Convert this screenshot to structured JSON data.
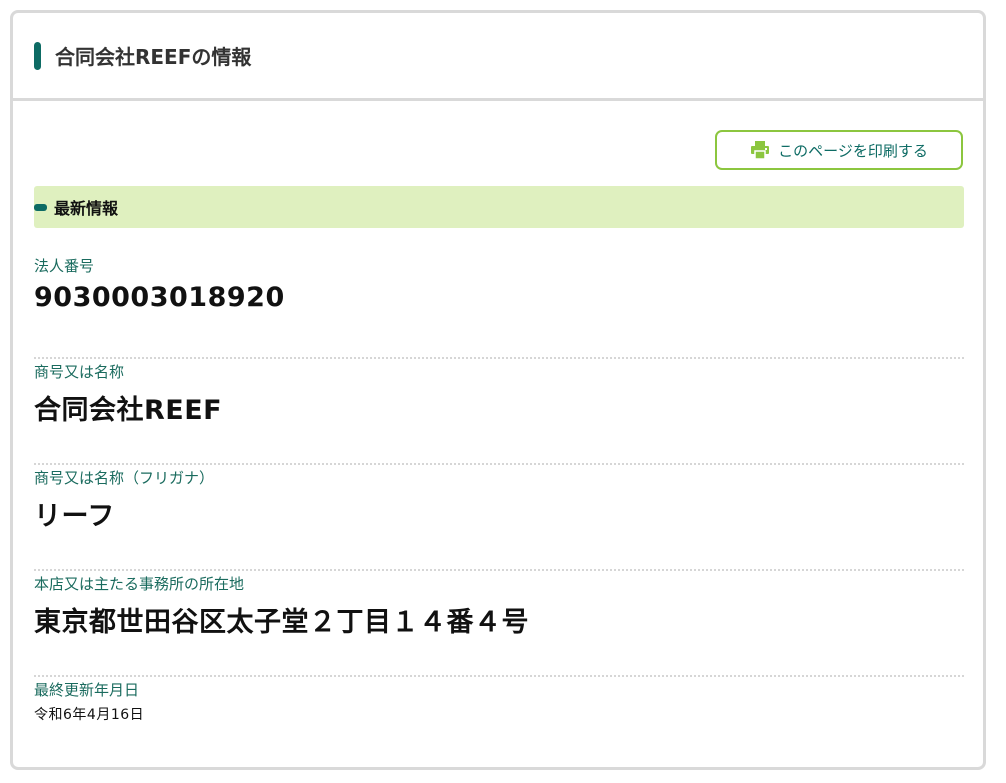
{
  "header": {
    "title": "合同会社REEFの情報"
  },
  "print_button": {
    "label": "このページを印刷する",
    "icon": "printer-icon"
  },
  "section": {
    "title": "最新情報"
  },
  "fields": [
    {
      "label": "法人番号",
      "value": "9030003018920"
    },
    {
      "label": "商号又は名称",
      "value": "合同会社REEF"
    },
    {
      "label": "商号又は名称（フリガナ）",
      "value": "リーフ"
    },
    {
      "label": "本店又は主たる事務所の所在地",
      "value": "東京都世田谷区太子堂２丁目１４番４号"
    },
    {
      "label": "最終更新年月日",
      "value": "令和6年4月16日"
    }
  ],
  "colors": {
    "accent": "#0d6b64",
    "button_border": "#8cc63f",
    "section_bg": "#dff0bf"
  }
}
